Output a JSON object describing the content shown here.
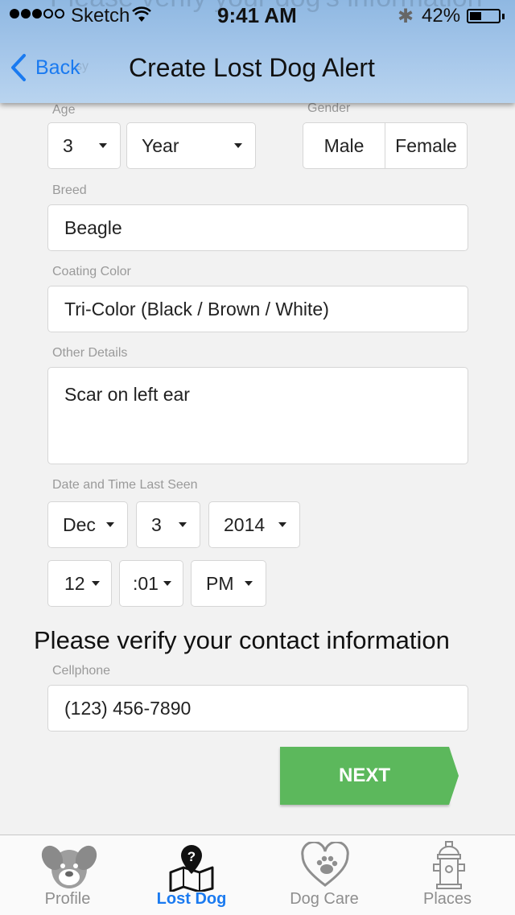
{
  "status_bar": {
    "carrier": "Sketch",
    "time": "9:41 AM",
    "battery": "42%",
    "battery_level": 0.42
  },
  "nav": {
    "back_label": "Back",
    "title": "Create Lost Dog Alert",
    "ghost_text": "Please verify your dog's information",
    "ghost_text_2": "sy"
  },
  "form": {
    "age_label": "Age",
    "age_value": "3",
    "age_unit": "Year",
    "gender_label": "Gender",
    "gender_options": [
      "Male",
      "Female"
    ],
    "breed_label": "Breed",
    "breed_value": "Beagle",
    "color_label": "Coating Color",
    "color_value": "Tri-Color (Black / Brown / White)",
    "details_label": "Other Details",
    "details_value": "Scar on left ear",
    "datetime_label": "Date and Time Last Seen",
    "month": "Dec",
    "day": "3",
    "year": "2014",
    "hour": "12",
    "minute": ":01",
    "ampm": "PM"
  },
  "contact": {
    "section_title": "Please verify your contact information",
    "cellphone_label": "Cellphone",
    "cellphone_value": "(123) 456-7890"
  },
  "next_label": "NEXT",
  "tabs": [
    {
      "label": "Profile",
      "icon": "dog-face-icon"
    },
    {
      "label": "Lost Dog",
      "icon": "lost-dog-map-icon",
      "active": true
    },
    {
      "label": "Dog Care",
      "icon": "heart-paw-icon"
    },
    {
      "label": "Places",
      "icon": "fire-hydrant-icon"
    }
  ],
  "colors": {
    "accent": "#1a7af0",
    "next_button": "#5cb85c",
    "header": "#a6c7ea"
  }
}
